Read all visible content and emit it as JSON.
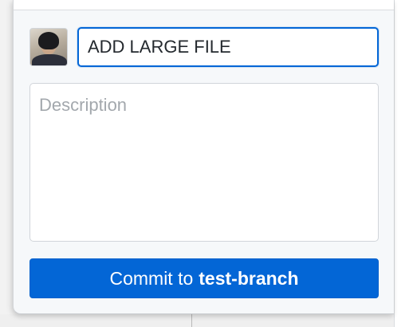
{
  "commit_form": {
    "summary_value": "ADD LARGE FILE",
    "description_placeholder": "Description",
    "commit_button": {
      "prefix": "Commit to",
      "branch": "test-branch"
    }
  },
  "colors": {
    "accent": "#0366d6",
    "panel_bg": "#f6f8fa"
  },
  "icons": {
    "avatar": "user-avatar-photo"
  }
}
